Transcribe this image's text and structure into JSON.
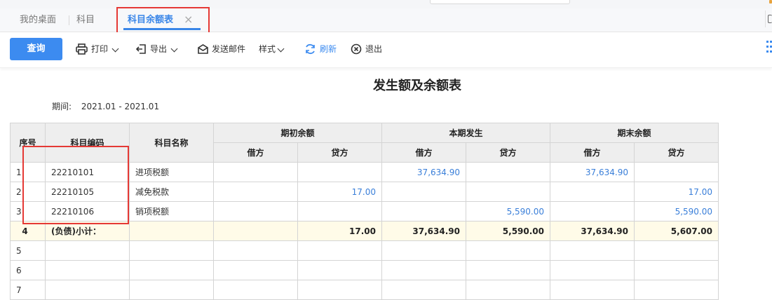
{
  "tabs": [
    {
      "label": "我的桌面"
    },
    {
      "label": "科目"
    },
    {
      "label": "科目余额表"
    }
  ],
  "toolbar": {
    "query": "查询",
    "print": "打印",
    "export": "导出",
    "send_mail": "发送邮件",
    "style": "样式",
    "refresh": "刷新",
    "exit": "退出"
  },
  "report": {
    "title": "发生额及余额表",
    "period_label": "期间:",
    "period_value": "2021.01 - 2021.01"
  },
  "table": {
    "headers": {
      "seq": "序号",
      "code": "科目编码",
      "name": "科目名称",
      "opening": "期初余额",
      "current": "本期发生",
      "closing": "期末余额",
      "debit": "借方",
      "credit": "贷方"
    },
    "rows": [
      {
        "seq": "1",
        "code": "22210101",
        "name": "进项税额",
        "open_debit": "",
        "open_credit": "",
        "cur_debit": "37,634.90",
        "cur_credit": "",
        "close_debit": "37,634.90",
        "close_credit": ""
      },
      {
        "seq": "2",
        "code": "22210105",
        "name": "减免税款",
        "open_debit": "",
        "open_credit": "17.00",
        "cur_debit": "",
        "cur_credit": "",
        "close_debit": "",
        "close_credit": "17.00"
      },
      {
        "seq": "3",
        "code": "22210106",
        "name": "销项税额",
        "open_debit": "",
        "open_credit": "",
        "cur_debit": "",
        "cur_credit": "5,590.00",
        "close_debit": "",
        "close_credit": "5,590.00"
      }
    ],
    "subtotal": {
      "seq": "4",
      "label": "(负债)小计：",
      "open_debit": "",
      "open_credit": "17.00",
      "cur_debit": "37,634.90",
      "cur_credit": "5,590.00",
      "close_debit": "37,634.90",
      "close_credit": "5,607.00"
    },
    "empty_rows": [
      {
        "seq": "5"
      },
      {
        "seq": "6"
      },
      {
        "seq": "7"
      }
    ]
  },
  "colors": {
    "accent": "#3c8bf0",
    "highlight": "#e53935",
    "subtotal_bg": "#fffbe8"
  }
}
